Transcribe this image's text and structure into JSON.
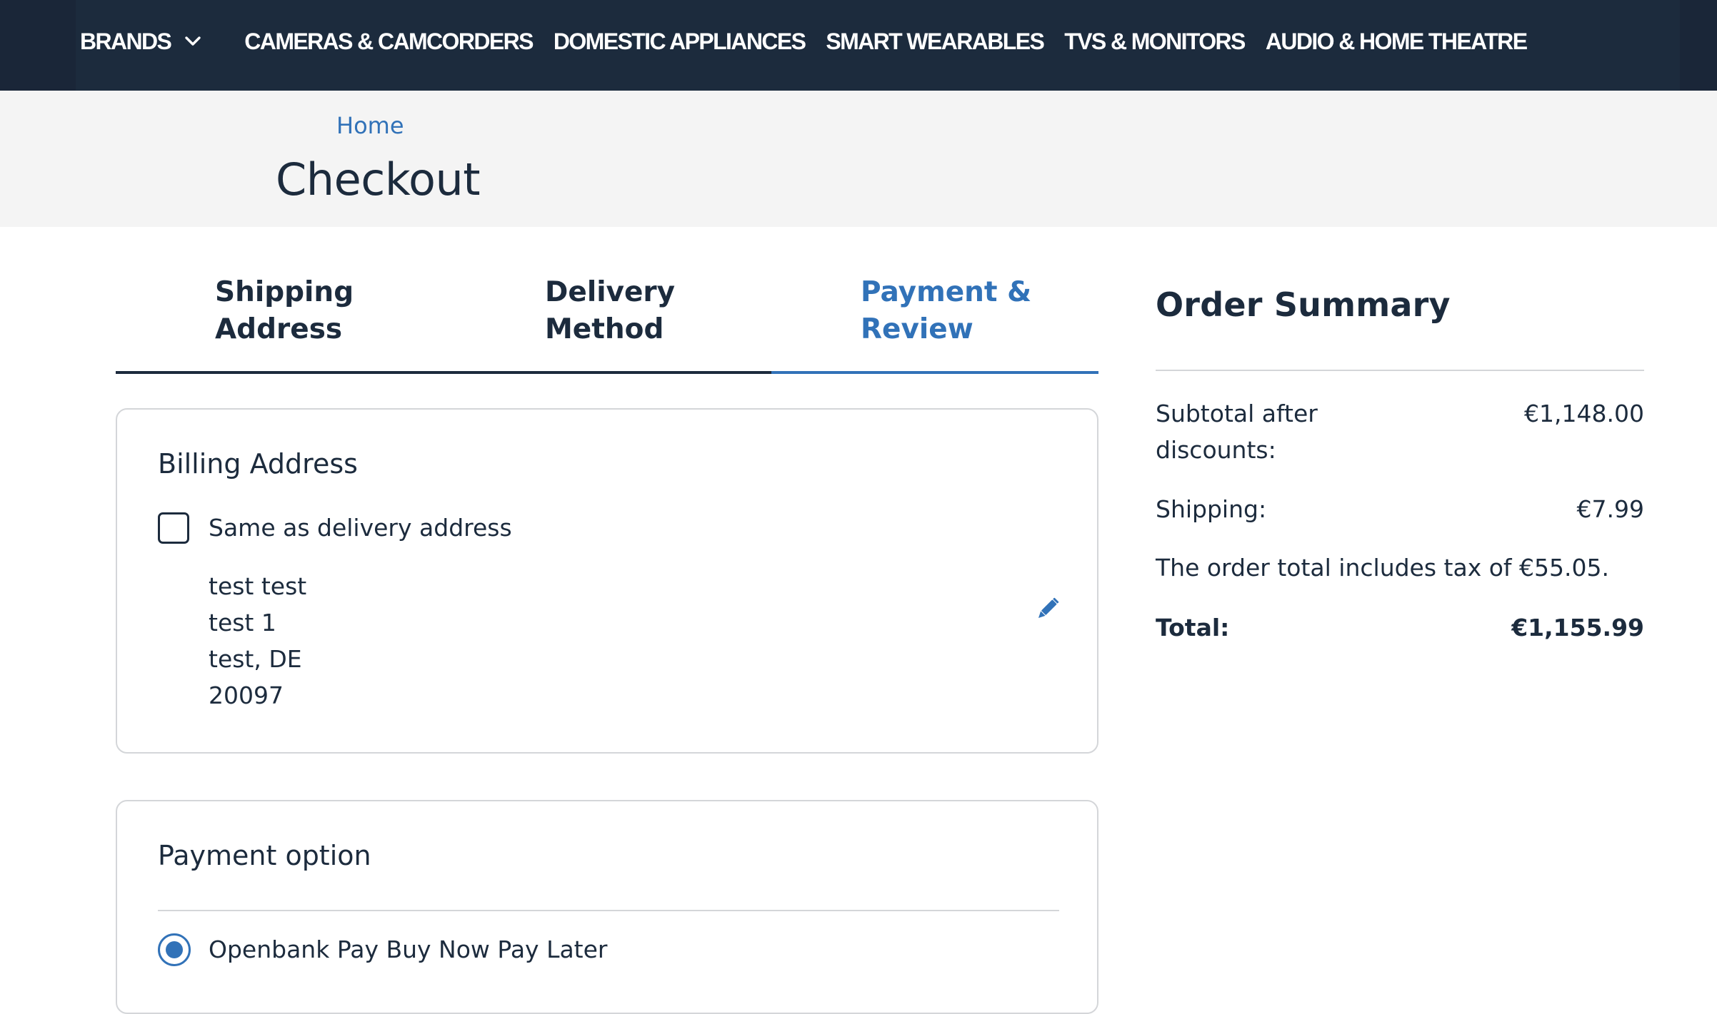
{
  "nav": {
    "items": [
      "BRANDS",
      "CAMERAS & CAMCORDERS",
      "DOMESTIC APPLIANCES",
      "SMART WEARABLES",
      "TVS & MONITORS",
      "AUDIO & HOME THEATRE"
    ],
    "brands_icon": "chevron-down-icon"
  },
  "breadcrumb": {
    "home": "Home"
  },
  "page": {
    "title": "Checkout"
  },
  "steps": [
    {
      "label": "Shipping Address",
      "state": "done"
    },
    {
      "label": "Delivery Method",
      "state": "done"
    },
    {
      "label": "Payment & Review",
      "state": "active"
    }
  ],
  "billing": {
    "title": "Billing Address",
    "same_as_delivery_label": "Same as delivery address",
    "same_as_delivery_checked": false,
    "address_lines": [
      "test test",
      "test 1",
      "test, DE",
      "20097"
    ],
    "edit_icon": "pencil-icon"
  },
  "payment": {
    "title": "Payment option",
    "selected_option": "Openbank Pay Buy Now Pay Later",
    "selected_icon": "radio-selected-icon"
  },
  "summary": {
    "title": "Order Summary",
    "subtotal_label": "Subtotal after discounts:",
    "subtotal_value": "€1,148.00",
    "shipping_label": "Shipping:",
    "shipping_value": "€7.99",
    "tax_note": "The order total includes tax of €55.05.",
    "total_label": "Total:",
    "total_value": "€1,155.99"
  },
  "colors": {
    "nav_bg": "#1c2b3d",
    "accent": "#3172b8",
    "band_bg": "#f4f4f4",
    "text": "#1c2b3d",
    "border": "#d4d6d9"
  }
}
